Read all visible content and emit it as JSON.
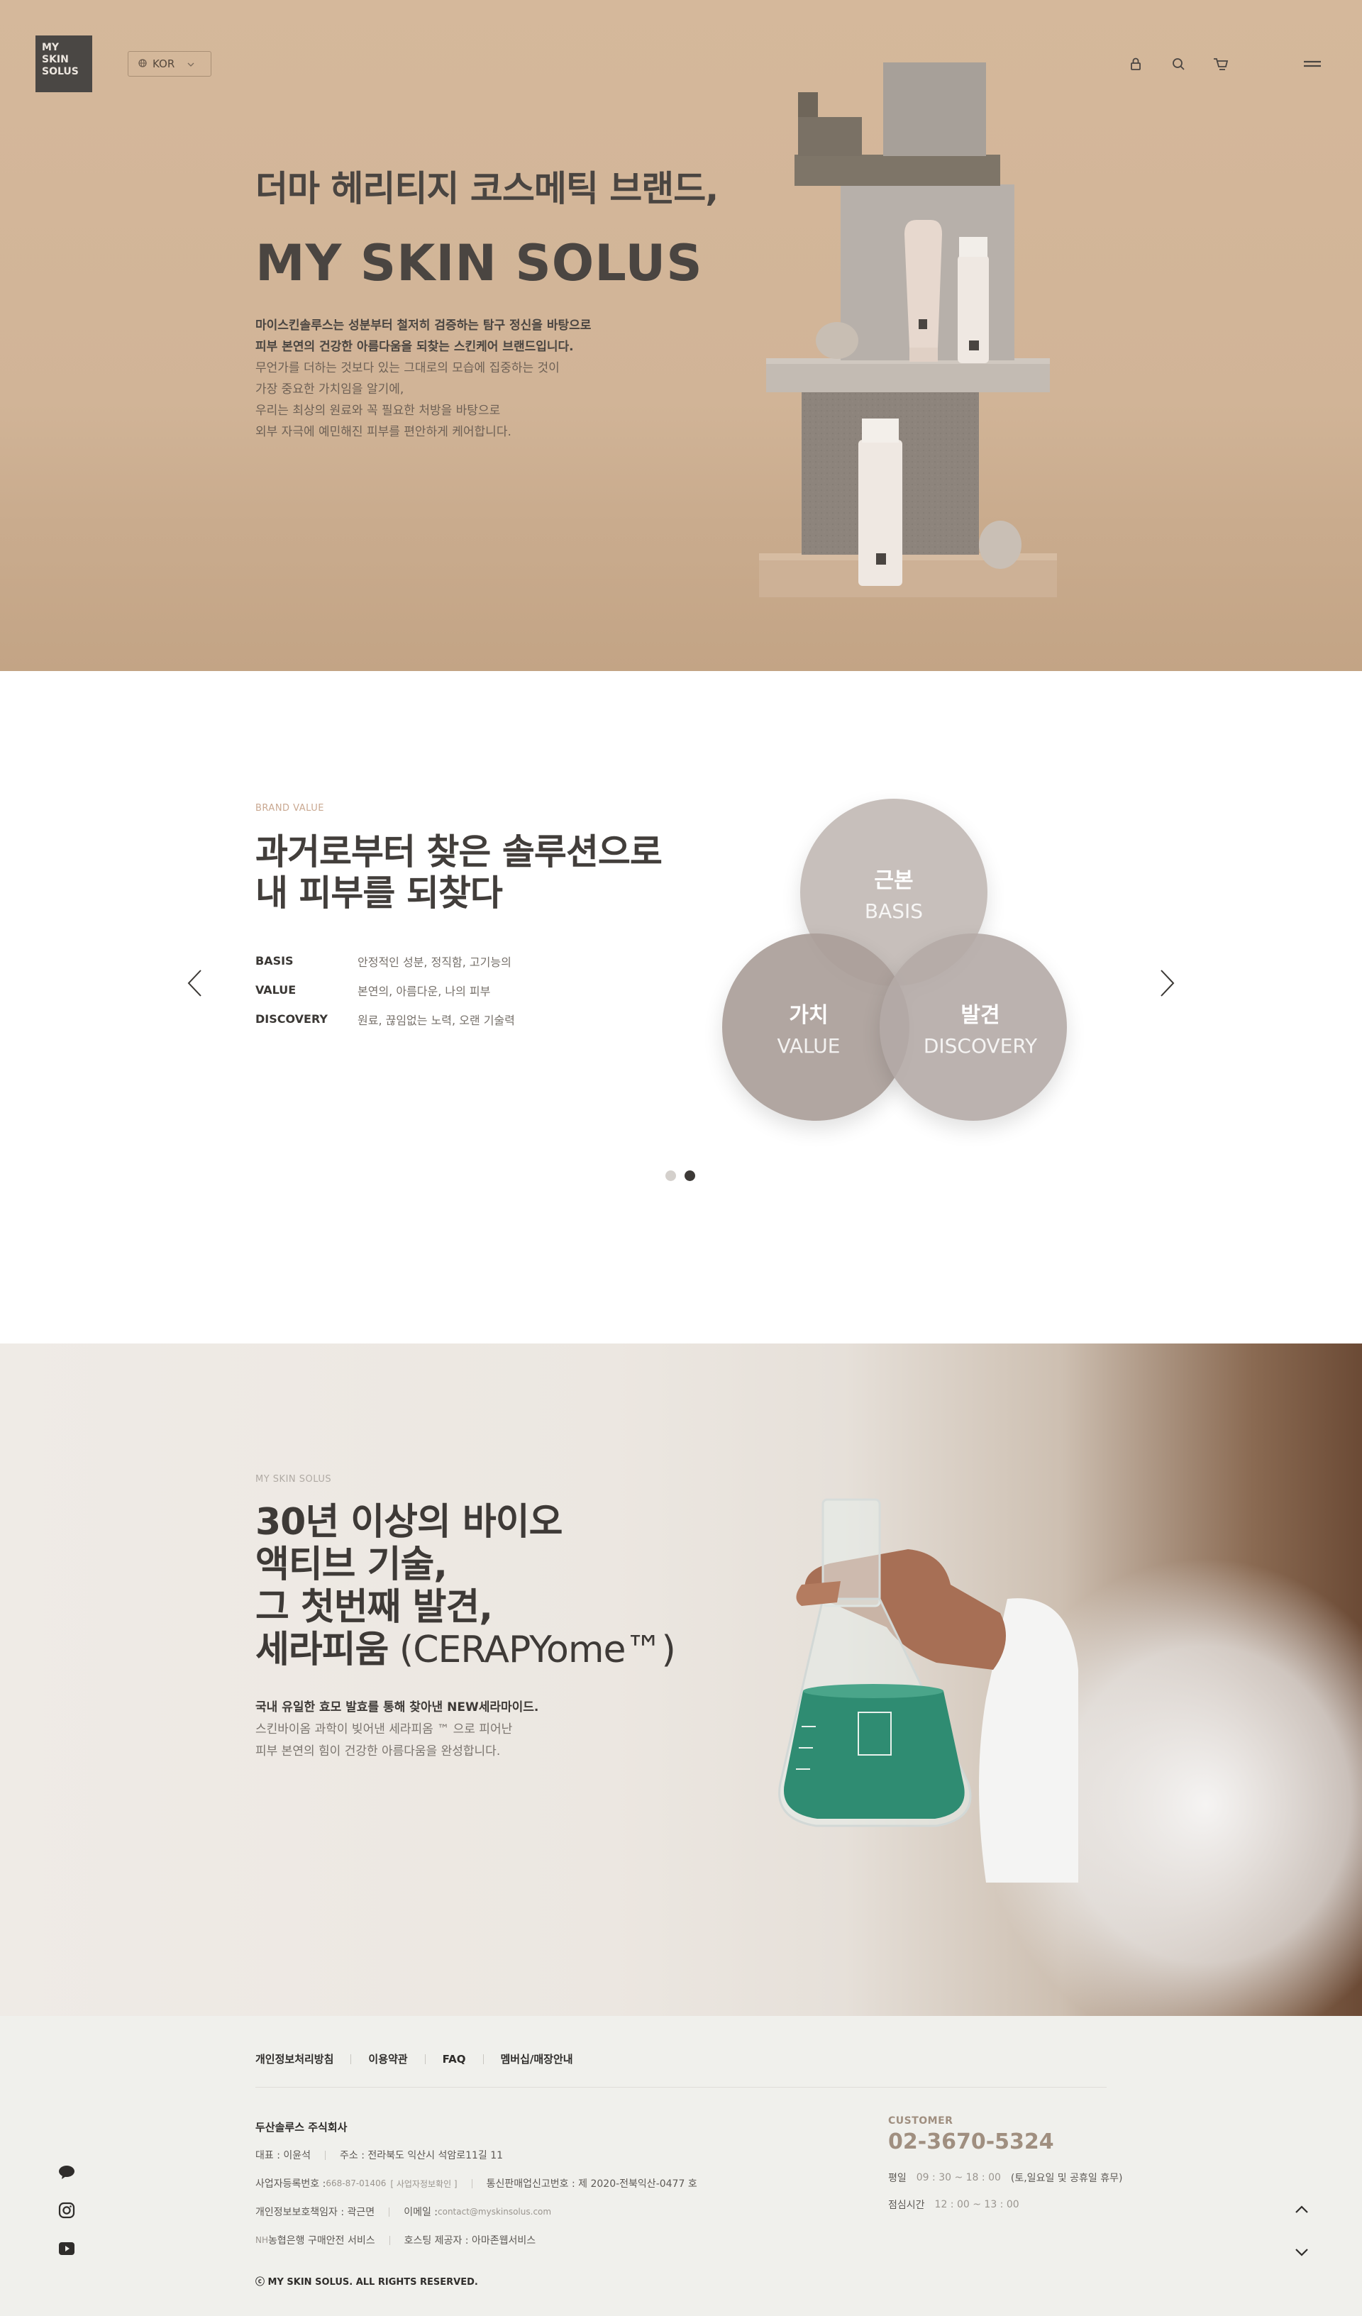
{
  "header": {
    "logo_lines": [
      "MY",
      "SKIN",
      "SOLUS"
    ],
    "language": "KOR",
    "icons": [
      "lock-icon",
      "search-icon",
      "cart-icon",
      "menu-icon"
    ]
  },
  "hero": {
    "subtitle": "더마 헤리티지 코스메틱 브랜드,",
    "title": "MY SKIN SOLUS",
    "desc_bold": [
      "마이스킨솔루스는 성분부터 철저히 검증하는 탐구 정신을 바탕으로",
      "피부 본연의 건강한 아름다움을 되찾는 스킨케어 브랜드입니다."
    ],
    "desc": [
      "무언가를 더하는 것보다 있는 그대로의 모습에 집중하는 것이",
      "가장 중요한 가치임을 알기에,",
      "우리는 최상의 원료와 꼭 필요한 처방을 바탕으로",
      "외부 자극에 예민해진 피부를 편안하게 케어합니다."
    ]
  },
  "brand_value": {
    "eyebrow": "BRAND VALUE",
    "title_lines": [
      "과거로부터 찾은 솔루션으로",
      "내 피부를 되찾다"
    ],
    "rows": [
      {
        "key": "BASIS",
        "desc": "안정적인 성분, 정직함, 고기능의"
      },
      {
        "key": "VALUE",
        "desc": "본연의, 아름다운, 나의 피부"
      },
      {
        "key": "DISCOVERY",
        "desc": "원료, 끊임없는 노력, 오랜 기술력"
      }
    ],
    "circles": [
      {
        "ko": "근본",
        "en": "BASIS"
      },
      {
        "ko": "가치",
        "en": "VALUE"
      },
      {
        "ko": "발견",
        "en": "DISCOVERY"
      }
    ],
    "slides_total": 2,
    "slide_active": 2
  },
  "bio": {
    "eyebrow": "MY SKIN SOLUS",
    "title_lines": [
      "30년 이상의 바이오",
      "액티브 기술,",
      "그 첫번째 발견,"
    ],
    "title_last_bold": "세라피움",
    "title_last_light": " (CERAPYome™)",
    "desc_bold": "국내 유일한 효모 발효를 통해 찾아낸 NEW세라마이드.",
    "desc": [
      "스킨바이옴 과학이 빚어낸 세라피옴 ™ 으로 피어난",
      "피부 본연의 힘이 건강한 아름다움을 완성합니다."
    ]
  },
  "footer": {
    "links": [
      "개인정보처리방침",
      "이용약관",
      "FAQ",
      "멤버십/매장안내"
    ],
    "company": "두산솔루스 주식회사",
    "line1": [
      "대표 : 이윤석",
      "주소 : 전라북도 익산시 석암로11길 11"
    ],
    "line2_a": "사업자등록번호 : ",
    "line2_a_val": "668-87-01406",
    "line2_a_link": "[ 사업자정보확인 ]",
    "line2_b": "통신판매업신고번호 : 제 2020-전북익산-0477 호",
    "line3_a": "개인정보보호책임자 : 곽근면",
    "line3_b": "이메일 : ",
    "line3_b_val": "contact@myskinsolus.com",
    "line4_a_prefix": "NH",
    "line4_a": "농협은행 구매안전 서비스",
    "line4_b": "호스팅 제공자 : 아마존웹서비스",
    "copyright": "ⓒ MY SKIN SOLUS. ALL RIGHTS RESERVED.",
    "customer_label": "CUSTOMER",
    "phone": "02-3670-5324",
    "hours": [
      {
        "label": "평일",
        "time": "09 : 30 ~ 18 : 00",
        "note": "(토,일요일 및 공휴일 휴무)"
      },
      {
        "label": "점심시간",
        "time": "12 : 00 ~ 13 : 00",
        "note": ""
      }
    ]
  },
  "colors": {
    "hero_bg": "#d5b89b",
    "circle_top": "#c7bfba",
    "circle_left": "#b3a8a3",
    "circle_right": "#b8adaa",
    "accent": "#a08f80"
  }
}
